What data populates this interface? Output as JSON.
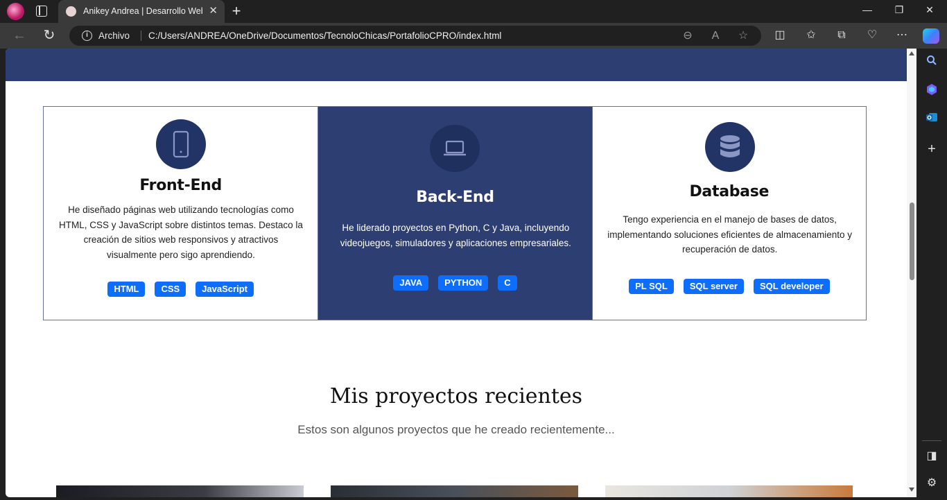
{
  "browser": {
    "tab_title": "Anikey Andrea | Desarrollo Web F",
    "tab_close": "✕",
    "new_tab": "+",
    "address_label": "Archivo",
    "url": "C:/Users/ANDREA/OneDrive/Documentos/TecnoloChicas/PortafolioCPRO/index.html",
    "window_controls": {
      "minimize": "—",
      "maximize": "❐",
      "close": "✕"
    }
  },
  "cards": [
    {
      "icon": "mobile-phone-icon",
      "title": "Front-End",
      "description": "He diseñado páginas web utilizando tecnologías como HTML, CSS y JavaScript sobre distintos temas. Destaco la creación de sitios web responsivos y atractivos visualmente pero sigo aprendiendo.",
      "tags": [
        "HTML",
        "CSS",
        "JavaScript"
      ]
    },
    {
      "icon": "laptop-icon",
      "title": "Back-End",
      "description": "He liderado proyectos en Python, C y Java, incluyendo videojuegos, simuladores y aplicaciones empresariales.",
      "tags": [
        "JAVA",
        "PYTHON",
        "C"
      ]
    },
    {
      "icon": "database-icon",
      "title": "Database",
      "description": "Tengo experiencia en el manejo de bases de datos, implementando soluciones eficientes de almacenamiento y recuperación de datos.",
      "tags": [
        "PL SQL",
        "SQL server",
        "SQL developer"
      ]
    }
  ],
  "projects": {
    "title": "Mis proyectos recientes",
    "subtitle": "Estos son algunos proyectos que he creado recientemente..."
  },
  "colors": {
    "navy": "#2d3e73",
    "icon_circle": "#223366",
    "tag_blue": "#0d6efd"
  }
}
